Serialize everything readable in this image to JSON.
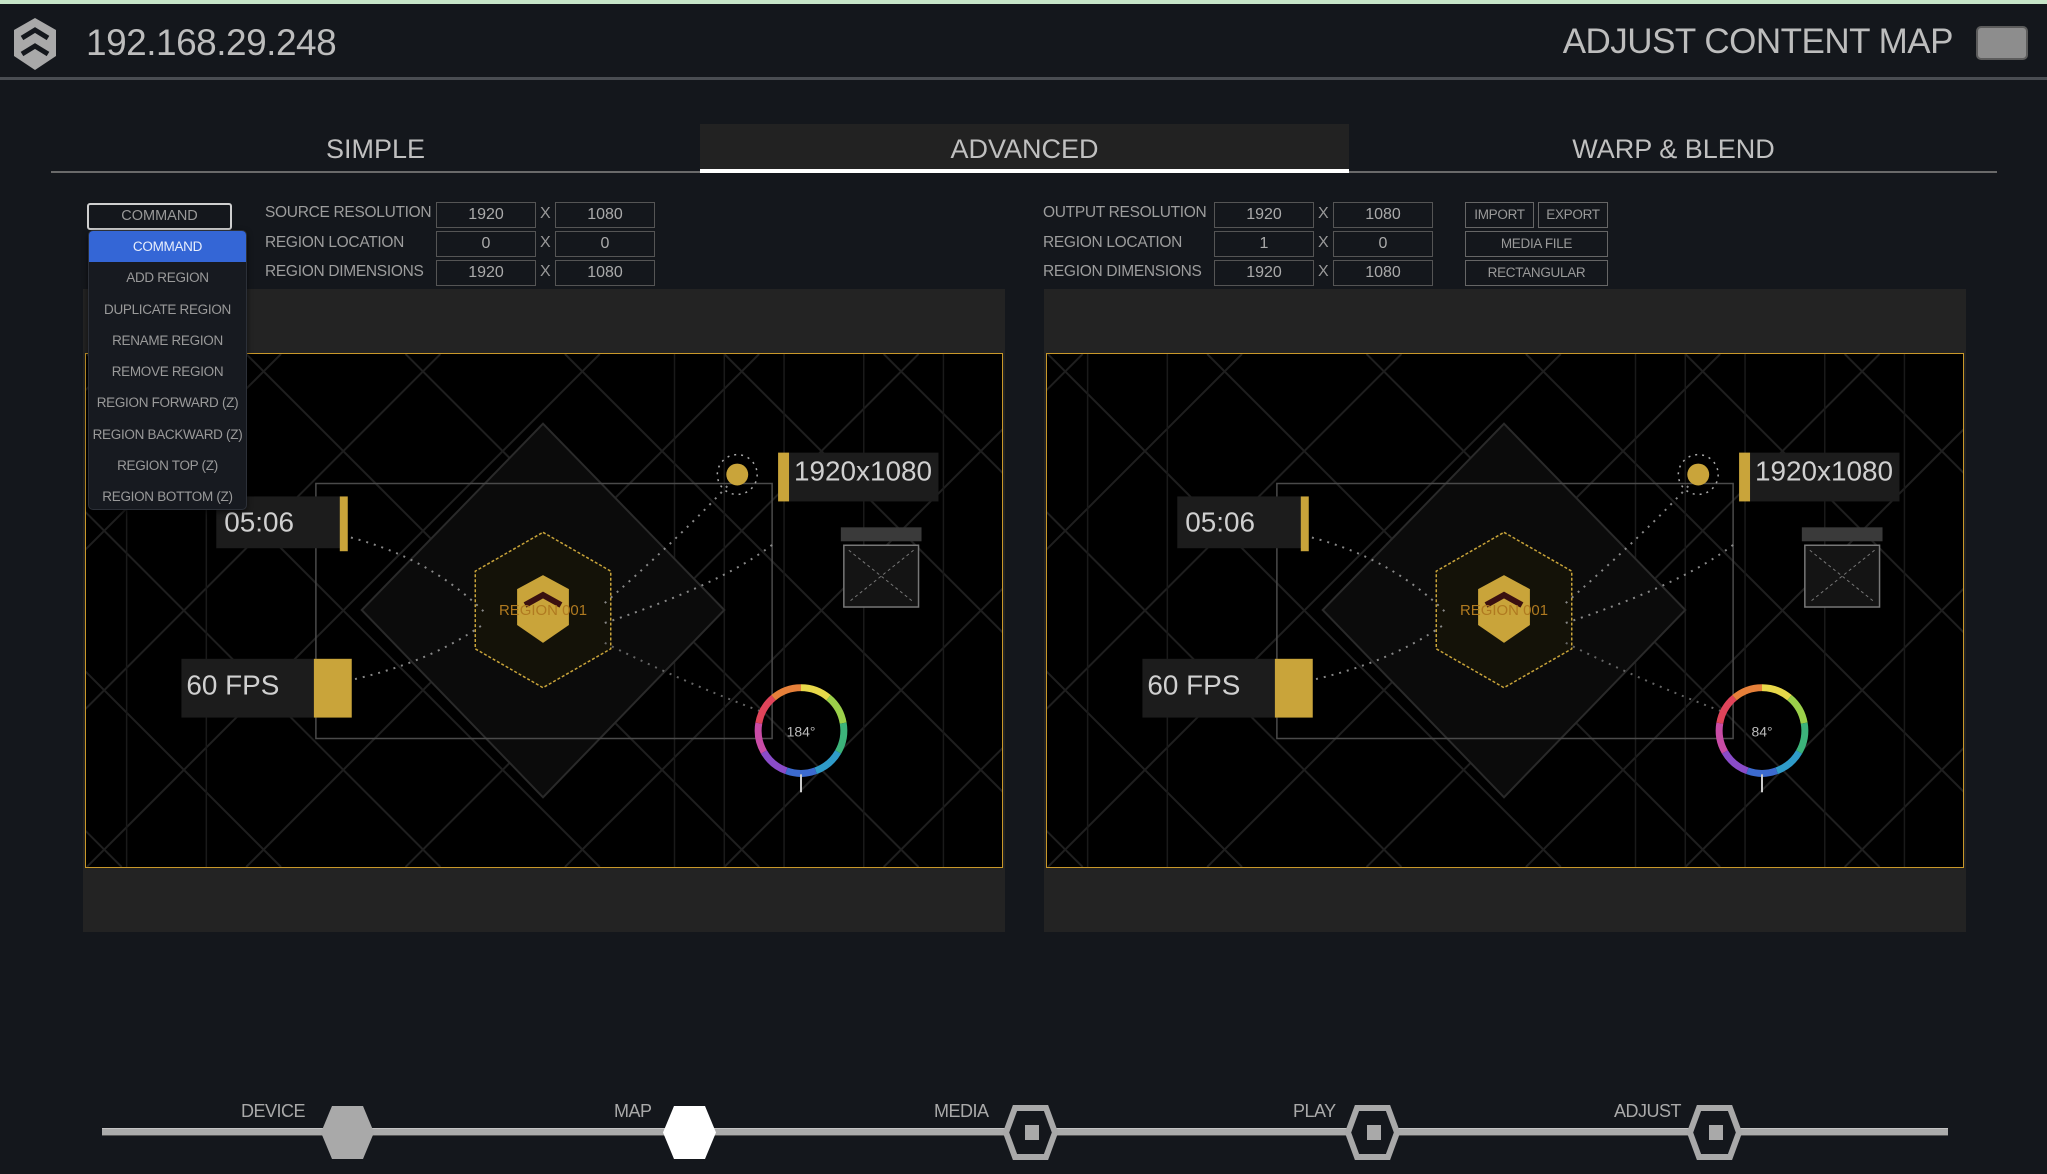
{
  "header": {
    "ip": "192.168.29.248",
    "title": "ADJUST CONTENT MAP",
    "toggle_on": false
  },
  "tabs": [
    {
      "label": "SIMPLE",
      "active": false
    },
    {
      "label": "ADVANCED",
      "active": true
    },
    {
      "label": "WARP & BLEND",
      "active": false
    }
  ],
  "source": {
    "command_select": "COMMAND",
    "resolution_label": "SOURCE RESOLUTION",
    "resolution": [
      "1920",
      "1080"
    ],
    "location_label": "REGION LOCATION",
    "location": [
      "0",
      "0"
    ],
    "dimensions_label": "REGION DIMENSIONS",
    "dimensions": [
      "1920",
      "1080"
    ],
    "separator": "X"
  },
  "command_menu": [
    {
      "label": "COMMAND",
      "selected": true
    },
    {
      "label": "ADD REGION"
    },
    {
      "label": "DUPLICATE REGION"
    },
    {
      "label": "RENAME REGION"
    },
    {
      "label": "REMOVE REGION"
    },
    {
      "label": "REGION FORWARD (Z)"
    },
    {
      "label": "REGION BACKWARD (Z)"
    },
    {
      "label": "REGION TOP (Z)"
    },
    {
      "label": "REGION BOTTOM (Z)"
    }
  ],
  "output": {
    "resolution_label": "OUTPUT RESOLUTION",
    "resolution": [
      "1920",
      "1080"
    ],
    "location_label": "REGION LOCATION",
    "location": [
      "1",
      "0"
    ],
    "dimensions_label": "REGION DIMENSIONS",
    "dimensions": [
      "1920",
      "1080"
    ],
    "separator": "X",
    "import_label": "IMPORT",
    "export_label": "EXPORT",
    "media_file_label": "MEDIA FILE",
    "rectangular_label": "RECTANGULAR"
  },
  "previews": {
    "source": {
      "resolution": "1920x1080",
      "time": "05:06",
      "fps": "60 FPS",
      "region": "REGION 001",
      "angle": "184°"
    },
    "output": {
      "resolution": "1920x1080",
      "time": "05:06",
      "fps": "60 FPS",
      "region": "REGION 001",
      "angle": "84°"
    }
  },
  "steps": [
    {
      "label": "DEVICE",
      "state": "complete"
    },
    {
      "label": "MAP",
      "state": "current"
    },
    {
      "label": "MEDIA",
      "state": "pending"
    },
    {
      "label": "PLAY",
      "state": "pending"
    },
    {
      "label": "ADJUST",
      "state": "pending"
    }
  ],
  "colors": {
    "accent": "#3466d6",
    "region_border": "#c9982a",
    "gold": "#c9a43a",
    "panel": "#232323",
    "background": "#14171c"
  }
}
